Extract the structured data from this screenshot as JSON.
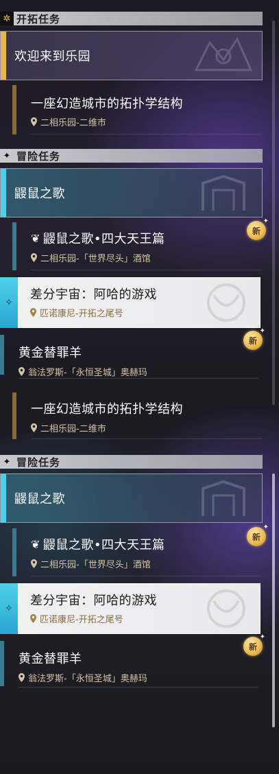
{
  "colors": {
    "main_accent": "#e8b64a",
    "adventure_accent": "#4fd0ea",
    "quest_bar_gold": "#8a6a2e",
    "quest_bar_teal": "#3b7b8f",
    "location_text": "#d4c4a4",
    "new_badge": "#e7b84e"
  },
  "sections": {
    "trailblaze_label": "开拓任务",
    "adventure_label_1": "冒险任务",
    "adventure_label_2": "冒险任务",
    "trailblaze_icon": "compass-icon",
    "adventure_icon": "four-point-star-icon"
  },
  "trailblaze": {
    "chapter": "欢迎来到乐园",
    "quest_title": "一座幻造城市的拓扑学结构",
    "quest_location": "二相乐园-二维市"
  },
  "adventure1": {
    "group": "鼹鼠之歌",
    "quest1_title": "鼹鼠之歌•四大天王篇",
    "quest1_location": "二相乐园-「世界尽头」酒馆",
    "quest1_badge": "新",
    "selected_title": "差分宇宙：阿哈的游戏",
    "selected_location": "匹诺康尼-开拓之尾号",
    "loose_title": "黄金替罪羊",
    "loose_location": "翁法罗斯-「永恒圣城」奥赫玛",
    "loose_badge": "新"
  },
  "trailblaze2": {
    "quest_title": "一座幻造城市的拓扑学结构",
    "quest_location": "二相乐园-二维市"
  },
  "adventure2": {
    "group": "鼹鼠之歌",
    "quest1_title": "鼹鼠之歌•四大天王篇",
    "quest1_location": "二相乐园-「世界尽头」酒馆",
    "quest1_badge": "新",
    "selected_title": "差分宇宙：阿哈的游戏",
    "selected_location": "匹诺康尼-开拓之尾号",
    "loose_title": "黄金替罪羊",
    "loose_location": "翁法罗斯-「永恒圣城」奥赫玛",
    "loose_badge": "新"
  }
}
